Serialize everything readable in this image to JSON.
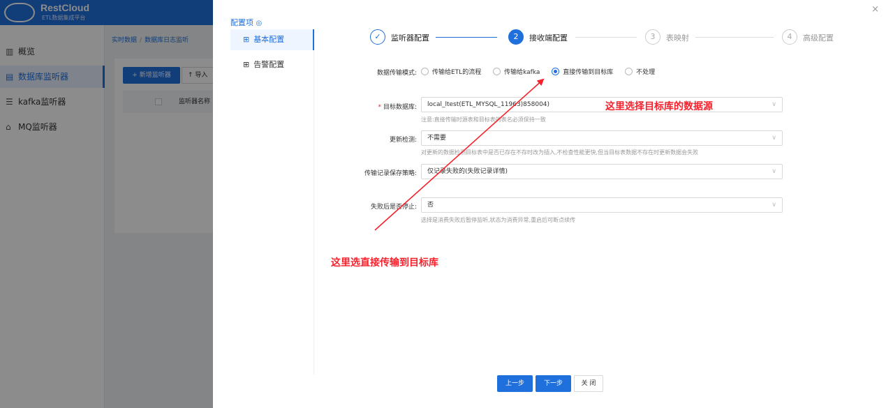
{
  "brand": {
    "name": "RestCloud",
    "subtitle": "ETL数据集成平台"
  },
  "sidebar": {
    "items": [
      {
        "icon": "bar-chart-icon",
        "glyph": "📊",
        "label": "概览"
      },
      {
        "icon": "database-icon",
        "glyph": "▤",
        "label": "数据库监听器",
        "active": true
      },
      {
        "icon": "list-icon",
        "glyph": "☰",
        "label": "kafka监听器"
      },
      {
        "icon": "mq-icon",
        "glyph": "⌂",
        "label": "MQ监听器"
      }
    ]
  },
  "breadcrumb": {
    "root": "实时数据",
    "sep": "/",
    "current": "数据库日志监听"
  },
  "background_panel": {
    "add_button": "+ 新增监听器",
    "import_button": "↑ 导入",
    "column_name": "监听器名称"
  },
  "drawer": {
    "close": "×",
    "config_title": "配置项",
    "nav": [
      {
        "label": "基本配置",
        "active": true
      },
      {
        "label": "告警配置"
      }
    ],
    "steps": [
      {
        "num": "✓",
        "label": "监听器配置",
        "state": "done"
      },
      {
        "num": "2",
        "label": "接收端配置",
        "state": "current"
      },
      {
        "num": "3",
        "label": "表映射",
        "state": "todo"
      },
      {
        "num": "4",
        "label": "高级配置",
        "state": "todo"
      }
    ],
    "form": {
      "mode_label": "数据传输模式:",
      "mode_options": [
        {
          "label": "传输给ETL的流程",
          "checked": false
        },
        {
          "label": "传输给kafka",
          "checked": false
        },
        {
          "label": "直接传输到目标库",
          "checked": true
        },
        {
          "label": "不处理",
          "checked": false
        }
      ],
      "target_db_label": "目标数据库:",
      "target_db_value": "local_ltest(ETL_MYSQL_11963)858004)",
      "target_db_hint": "注意:直接传输时源表和目标表的表名必须保持一致",
      "update_check_label": "更新检测:",
      "update_check_value": "不需要",
      "update_check_hint": "对更新的数据检测目标表中是否已存在不存时改为插入,不检查性能更快,但当目标表数据不存在时更新数据会失败",
      "log_policy_label": "传输记录保存策略:",
      "log_policy_value": "仅记录失败的(失败记录详情)",
      "stop_on_fail_label": "失败后是否停止:",
      "stop_on_fail_value": "否",
      "stop_on_fail_hint": "选择是消费失败后暂停监听,状态为消费异常,重启后可断点续传"
    },
    "annotations": {
      "target_db_note": "这里选择目标库的数据源",
      "mode_note": "这里选直接传输到目标库"
    },
    "footer": {
      "prev": "上一步",
      "next": "下一步",
      "close": "关 闭"
    }
  },
  "colors": {
    "primary": "#1f6fdc",
    "annotation": "#f5222d"
  }
}
